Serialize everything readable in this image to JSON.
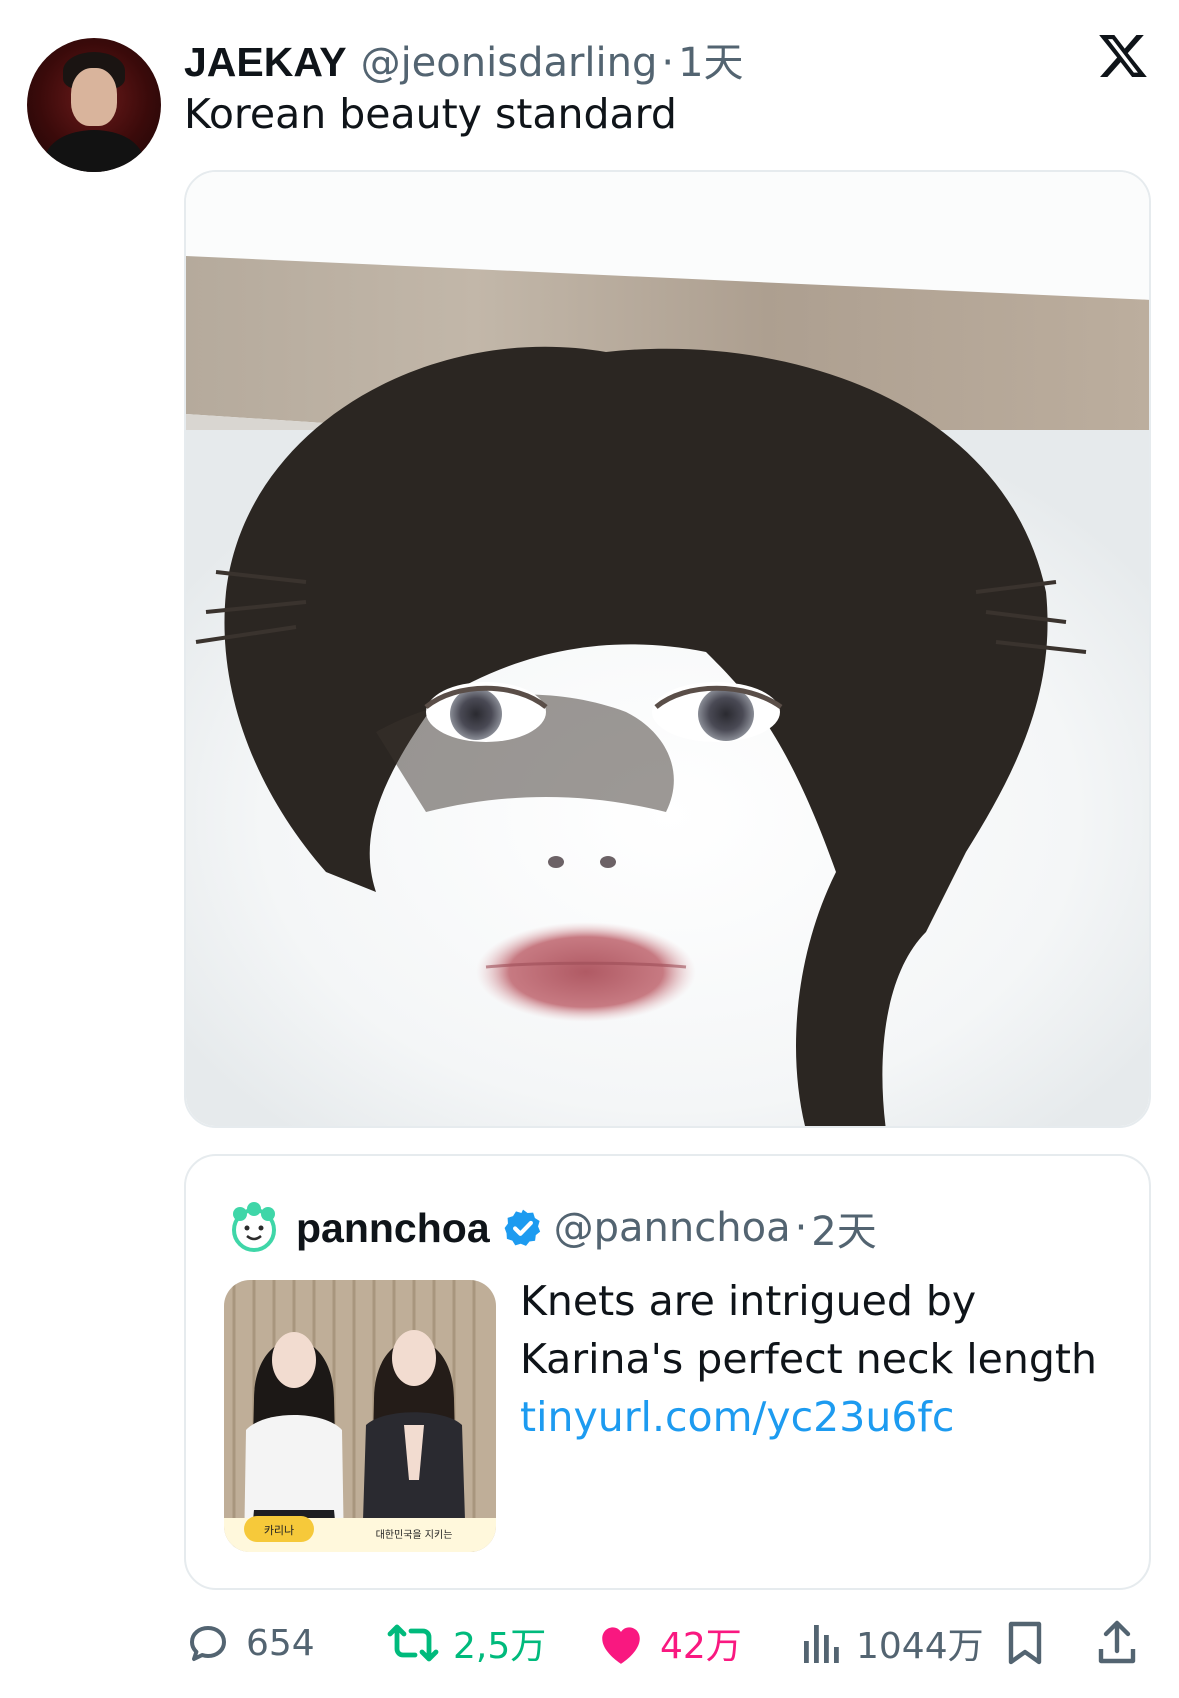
{
  "tweet": {
    "author_name": "JAEKAY",
    "author_handle": "@jeonisdarling",
    "separator": "·",
    "time": "1天",
    "text": "Korean beauty standard"
  },
  "quoted": {
    "author_name": "pannchoa",
    "author_handle": "@pannchoa",
    "separator": "·",
    "time": "2天",
    "text_lines": [
      "Knets are intrigued by",
      "Karina's perfect neck length"
    ],
    "link": "tinyurl.com/yc23u6fc",
    "thumbnail_caption_name": "카리나",
    "thumbnail_caption_text": "대한민국을 지키는"
  },
  "actions": {
    "reply_count": "654",
    "retweet_count": "2,5万",
    "like_count": "42万",
    "view_count": "1044万"
  },
  "colors": {
    "text": "#0f1419",
    "secondary": "#536471",
    "link": "#1d9bf0",
    "retweet": "#00ba7c",
    "like": "#f91880",
    "verified": "#1d9bf0"
  },
  "icons": {
    "brand": "x-logo-icon",
    "reply": "comment-bubble-icon",
    "retweet": "retweet-arrows-icon",
    "like": "heart-icon",
    "views": "bar-chart-icon",
    "bookmark": "bookmark-icon",
    "share": "share-upload-icon",
    "verified": "verified-badge-icon"
  }
}
